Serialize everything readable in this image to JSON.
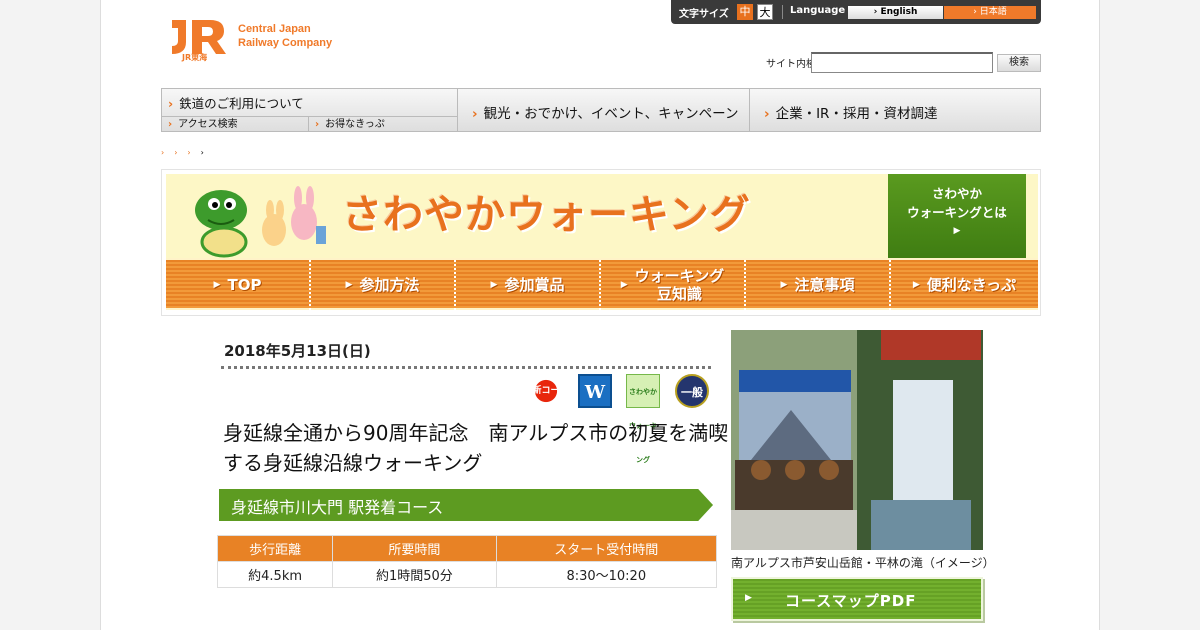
{
  "header": {
    "logo_line1": "Central Japan",
    "logo_line2": "Railway Company",
    "logo_mark": "JR東海",
    "font_size_label": "文字サイズ",
    "font_mid": "中",
    "font_big": "大",
    "language_label": "Language",
    "lang_en": "› English",
    "lang_ja": "› 日本語",
    "search_label": "サイト内検索",
    "search_button": "検索"
  },
  "nav": {
    "rail": "鉄道のご利用について",
    "access": "アクセス検索",
    "tickets": "お得なきっぷ",
    "sightseeing": "観光・おでかけ、イベント、キャンペーン",
    "corporate": "企業・IR・採用・資材調達"
  },
  "breadcrumb": [
    "›",
    "›",
    "›",
    "›"
  ],
  "banner": {
    "title": "さわやかウォーキング",
    "about": [
      "さわやか",
      "ウォーキングとは"
    ],
    "menu": [
      {
        "label": "TOP"
      },
      {
        "label": "参加方法"
      },
      {
        "label": "参加賞品"
      },
      {
        "label": "ウォーキング\n豆知識"
      },
      {
        "label": "注意事項"
      },
      {
        "label": "便利なきっぷ"
      }
    ]
  },
  "event": {
    "date": "2018年5月13日(日)",
    "badges": [
      "新コース",
      "W",
      "スタンプ",
      "さわやかウォーキング",
      "一般向"
    ],
    "title": "身延線全通から90周年記念　南アルプス市の初夏を満喫する身延線沿線ウォーキング",
    "course_name": "身延線市川大門 駅発着コース",
    "table_headers": [
      "歩行距離",
      "所要時間",
      "スタート受付時間"
    ],
    "table_values": [
      "約4.5km",
      "約1時間50分",
      "8:30～10:20"
    ],
    "photo_caption": "南アルプス市芦安山岳館・平林の滝（イメージ）",
    "pdf_button": "コースマップPDF"
  },
  "colors": {
    "accent": "#e8711e",
    "green": "#5d9b21"
  }
}
